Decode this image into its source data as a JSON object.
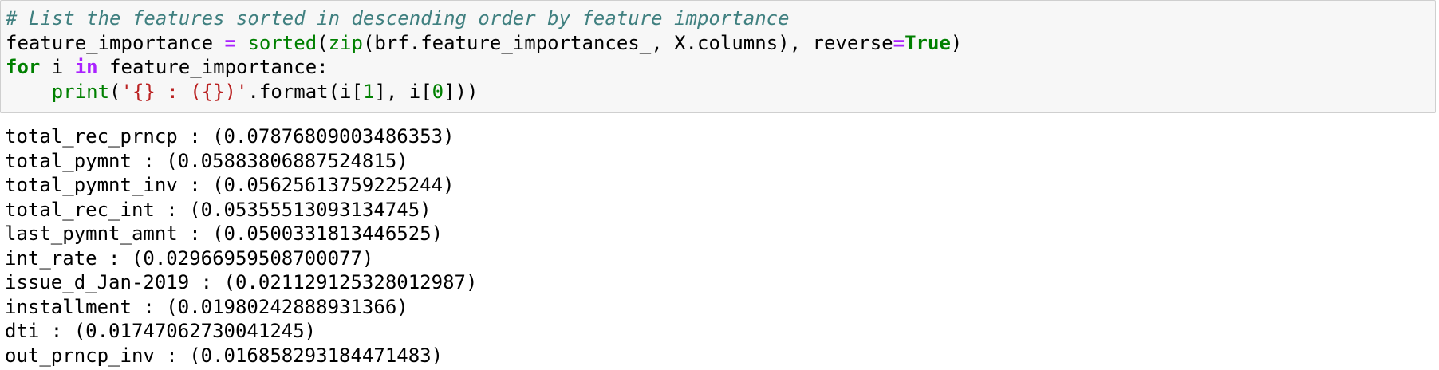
{
  "code_cell": {
    "line1": {
      "comment": "# List the features sorted in descending order by feature importance"
    },
    "line2": {
      "var": "feature_importance",
      "eq": " = ",
      "sorted": "sorted",
      "mid1": "(",
      "zip": "zip",
      "mid2": "(brf.feature_importances_, X.columns), reverse",
      "eq2": "=",
      "true_kw": "True",
      "end": ")"
    },
    "line3": {
      "for_kw": "for",
      "mid1": " i ",
      "in_kw": "in",
      "rest": " feature_importance:"
    },
    "line4": {
      "indent": "    ",
      "print": "print",
      "open": "(",
      "str": "'{} : ({})'",
      "mid": ".format(i[",
      "n1": "1",
      "mid2": "], i[",
      "n0": "0",
      "end": "]))"
    }
  },
  "output_lines": [
    "total_rec_prncp : (0.07876809003486353)",
    "total_pymnt : (0.05883806887524815)",
    "total_pymnt_inv : (0.05625613759225244)",
    "total_rec_int : (0.05355513093134745)",
    "last_pymnt_amnt : (0.0500331813446525)",
    "int_rate : (0.02966959508700077)",
    "issue_d_Jan-2019 : (0.021129125328012987)",
    "installment : (0.01980242888931366)",
    "dti : (0.01747062730041245)",
    "out_prncp_inv : (0.016858293184471483)"
  ]
}
